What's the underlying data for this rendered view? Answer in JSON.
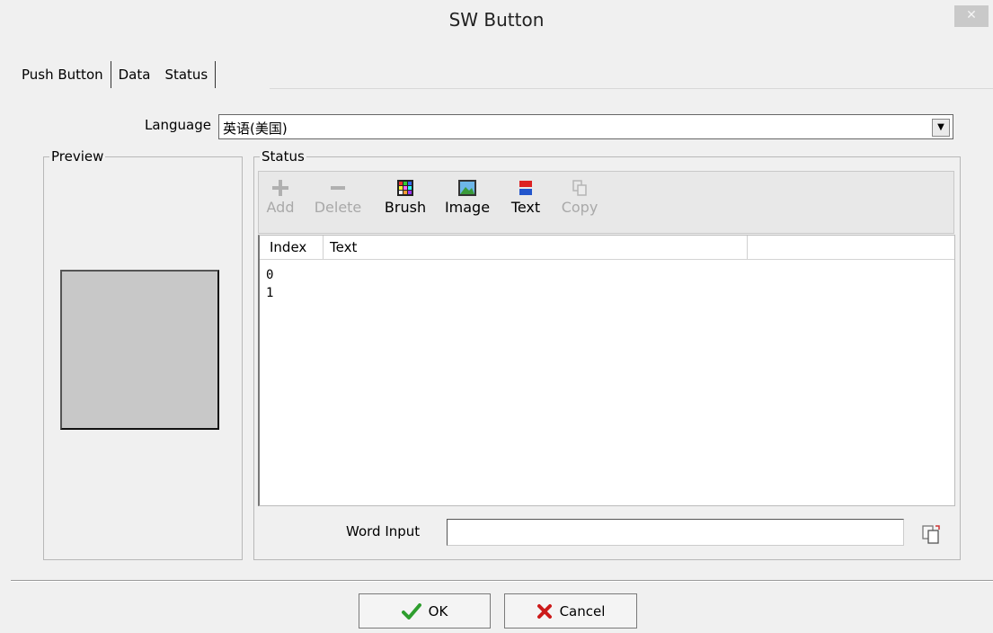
{
  "window": {
    "title": "SW Button",
    "close_glyph": "✕"
  },
  "tabs": [
    {
      "label": "Push Button"
    },
    {
      "label": "Data"
    },
    {
      "label": "Status",
      "active": true
    }
  ],
  "language": {
    "label": "Language",
    "value": "英语(美国)"
  },
  "preview": {
    "legend": "Preview",
    "fill_color": "#c8c8c8"
  },
  "status": {
    "legend": "Status",
    "toolbar": [
      {
        "label": "Add",
        "icon": "plus-icon",
        "enabled": false
      },
      {
        "label": "Delete",
        "icon": "minus-icon",
        "enabled": false
      },
      {
        "label": "Brush",
        "icon": "brush-icon",
        "enabled": true
      },
      {
        "label": "Image",
        "icon": "image-icon",
        "enabled": true
      },
      {
        "label": "Text",
        "icon": "text-icon",
        "enabled": true
      },
      {
        "label": "Copy",
        "icon": "copy-icon",
        "enabled": false
      }
    ],
    "columns": [
      "Index",
      "Text"
    ],
    "rows": [
      {
        "index": "0",
        "text": ""
      },
      {
        "index": "1",
        "text": ""
      }
    ]
  },
  "word_input": {
    "label": "Word Input",
    "value": ""
  },
  "footer": {
    "ok_label": "OK",
    "cancel_label": "Cancel"
  },
  "colors": {
    "ok_check": "#2e9e2e",
    "cancel_x": "#cc1a1a"
  }
}
